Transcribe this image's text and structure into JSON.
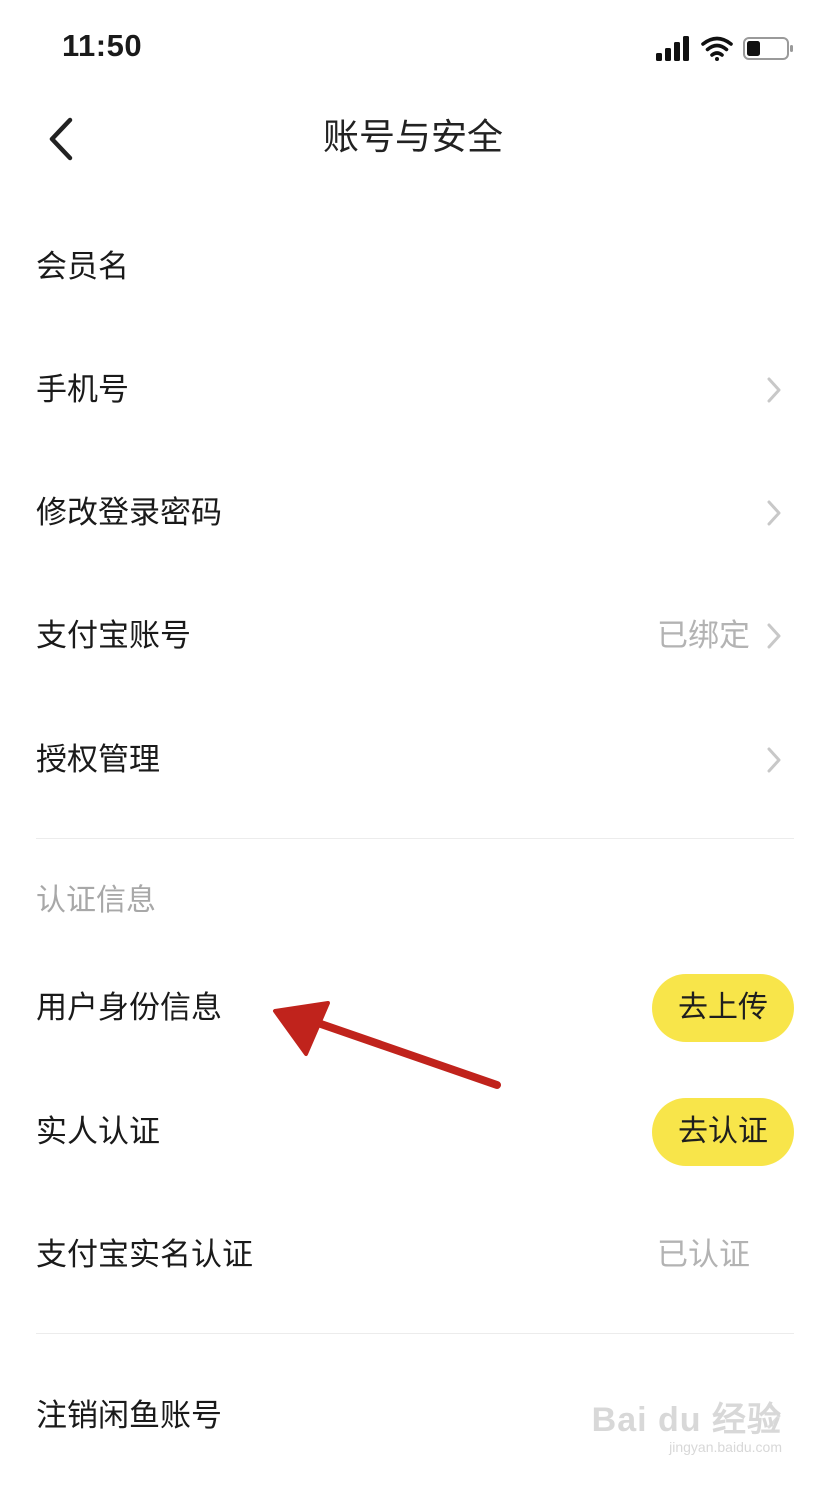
{
  "status_bar": {
    "time": "11:50"
  },
  "nav": {
    "title": "账号与安全"
  },
  "rows_top": [
    {
      "label": "会员名",
      "value": "",
      "chevron": false
    },
    {
      "label": "手机号",
      "value": "",
      "chevron": true
    },
    {
      "label": "修改登录密码",
      "value": "",
      "chevron": true
    },
    {
      "label": "支付宝账号",
      "value": "已绑定",
      "chevron": true
    },
    {
      "label": "授权管理",
      "value": "",
      "chevron": true
    }
  ],
  "section": {
    "title": "认证信息"
  },
  "auth_rows": [
    {
      "label": "用户身份信息",
      "button": "去上传"
    },
    {
      "label": "实人认证",
      "button": "去认证"
    },
    {
      "label": "支付宝实名认证",
      "value": "已认证"
    }
  ],
  "bottom_row": {
    "label": "注销闲鱼账号"
  },
  "watermark": {
    "main": "Bai du 经验",
    "sub": "jingyan.baidu.com"
  },
  "colors": {
    "accent_yellow": "#f8e54a",
    "annotation_red": "#c0231c",
    "muted_text": "#b3b3b3"
  }
}
